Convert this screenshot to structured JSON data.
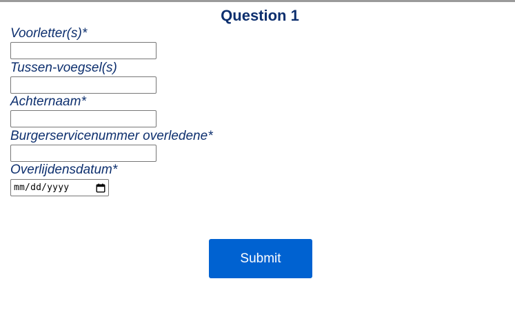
{
  "form": {
    "title": "Question 1",
    "fields": [
      {
        "label": "Voorletter(s)*",
        "value": ""
      },
      {
        "label": "Tussen-voegsel(s)",
        "value": ""
      },
      {
        "label": "Achternaam*",
        "value": ""
      },
      {
        "label": "Burgerservicenummer overledene*",
        "value": ""
      },
      {
        "label": "Overlijdensdatum*",
        "placeholder": "mm/dd/yyyy"
      }
    ],
    "submit_label": "Submit"
  },
  "colors": {
    "label": "#0d2f6e",
    "button": "#0062d1",
    "top_rule": "#9a9a9a"
  },
  "icons": {
    "date_picker": "calendar-icon"
  }
}
